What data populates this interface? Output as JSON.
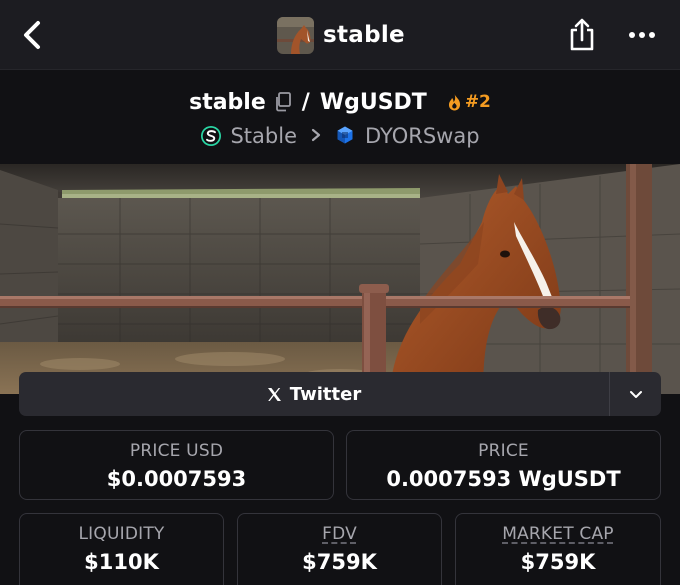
{
  "nav": {
    "title": "stable",
    "back_icon": "chevron-left-icon",
    "share_icon": "share-icon",
    "more_icon": "more-horizontal-icon"
  },
  "pair": {
    "base": "stable",
    "separator": "/",
    "quote": "WgUSDT",
    "rank": "#2",
    "rank_color": "#f39b21"
  },
  "breadcrumbs": [
    {
      "label": "Stable",
      "icon": "stable-chain-icon"
    },
    {
      "label": "DYORSwap",
      "icon": "dyorswap-icon"
    }
  ],
  "buttons": {
    "twitter_label": "Twitter"
  },
  "stats": {
    "price_usd": {
      "label": "PRICE USD",
      "value": "$0.0007593"
    },
    "price": {
      "label": "PRICE",
      "value": "0.0007593 WgUSDT"
    },
    "liquidity": {
      "label": "LIQUIDITY",
      "value": "$110K"
    },
    "fdv": {
      "label": "FDV",
      "value": "$759K"
    },
    "market_cap": {
      "label": "MARKET CAP",
      "value": "$759K"
    }
  },
  "colors": {
    "background": "#111114",
    "topbar": "#1c1c21",
    "card_border": "#34343b",
    "muted_text": "#a6a6ad",
    "accent_orange": "#f39b21"
  }
}
